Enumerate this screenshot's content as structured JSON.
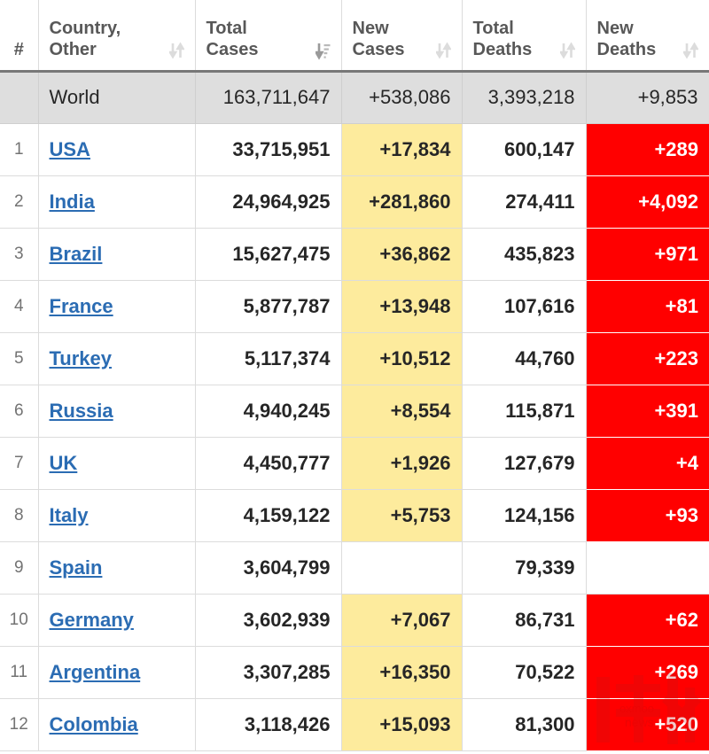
{
  "table": {
    "columns": [
      {
        "key": "rank",
        "label": "#",
        "sort_icon": "sort-both-icon",
        "sorted": false
      },
      {
        "key": "country",
        "label": "Country,\nOther",
        "sort_icon": "sort-both-icon",
        "sorted": false
      },
      {
        "key": "total_cases",
        "label": "Total\nCases",
        "sort_icon": "sort-descending-icon",
        "sorted": true
      },
      {
        "key": "new_cases",
        "label": "New\nCases",
        "sort_icon": "sort-both-icon",
        "sorted": false
      },
      {
        "key": "total_deaths",
        "label": "Total\nDeaths",
        "sort_icon": "sort-both-icon",
        "sorted": false
      },
      {
        "key": "new_deaths",
        "label": "New\nDeaths",
        "sort_icon": "sort-both-icon",
        "sorted": false
      }
    ],
    "column_labels": {
      "rank": "#",
      "country_line1": "Country,",
      "country_line2": "Other",
      "total_cases_line1": "Total",
      "total_cases_line2": "Cases",
      "new_cases_line1": "New",
      "new_cases_line2": "Cases",
      "total_deaths_line1": "Total",
      "total_deaths_line2": "Deaths",
      "new_deaths_line1": "New",
      "new_deaths_line2": "Deaths"
    },
    "world_row": {
      "rank": "",
      "country": "World",
      "total_cases": "163,711,647",
      "new_cases": "+538,086",
      "total_deaths": "3,393,218",
      "new_deaths": "+9,853"
    },
    "rows": [
      {
        "rank": "1",
        "country": "USA",
        "total_cases": "33,715,951",
        "new_cases": "+17,834",
        "total_deaths": "600,147",
        "new_deaths": "+289"
      },
      {
        "rank": "2",
        "country": "India",
        "total_cases": "24,964,925",
        "new_cases": "+281,860",
        "total_deaths": "274,411",
        "new_deaths": "+4,092"
      },
      {
        "rank": "3",
        "country": "Brazil",
        "total_cases": "15,627,475",
        "new_cases": "+36,862",
        "total_deaths": "435,823",
        "new_deaths": "+971"
      },
      {
        "rank": "4",
        "country": "France",
        "total_cases": "5,877,787",
        "new_cases": "+13,948",
        "total_deaths": "107,616",
        "new_deaths": "+81"
      },
      {
        "rank": "5",
        "country": "Turkey",
        "total_cases": "5,117,374",
        "new_cases": "+10,512",
        "total_deaths": "44,760",
        "new_deaths": "+223"
      },
      {
        "rank": "6",
        "country": "Russia",
        "total_cases": "4,940,245",
        "new_cases": "+8,554",
        "total_deaths": "115,871",
        "new_deaths": "+391"
      },
      {
        "rank": "7",
        "country": "UK",
        "total_cases": "4,450,777",
        "new_cases": "+1,926",
        "total_deaths": "127,679",
        "new_deaths": "+4"
      },
      {
        "rank": "8",
        "country": "Italy",
        "total_cases": "4,159,122",
        "new_cases": "+5,753",
        "total_deaths": "124,156",
        "new_deaths": "+93"
      },
      {
        "rank": "9",
        "country": "Spain",
        "total_cases": "3,604,799",
        "new_cases": "",
        "total_deaths": "79,339",
        "new_deaths": ""
      },
      {
        "rank": "10",
        "country": "Germany",
        "total_cases": "3,602,939",
        "new_cases": "+7,067",
        "total_deaths": "86,731",
        "new_deaths": "+62"
      },
      {
        "rank": "11",
        "country": "Argentina",
        "total_cases": "3,307,285",
        "new_cases": "+16,350",
        "total_deaths": "70,522",
        "new_deaths": "+269"
      },
      {
        "rank": "12",
        "country": "Colombia",
        "total_cases": "3,118,426",
        "new_cases": "+15,093",
        "total_deaths": "81,300",
        "new_deaths": "+520"
      }
    ]
  },
  "watermark": {
    "name": "oxmoo-news-watermark",
    "text_line1": "oxmoo",
    "text_line2": "news"
  },
  "colors": {
    "new_cases_highlight": "#fdeb9d",
    "new_deaths_highlight": "#ff0000",
    "world_row_background": "#dedede",
    "link": "#2b6cb3",
    "header_text": "#585858",
    "body_text": "#262626",
    "grid_line": "#dcdcdc"
  }
}
